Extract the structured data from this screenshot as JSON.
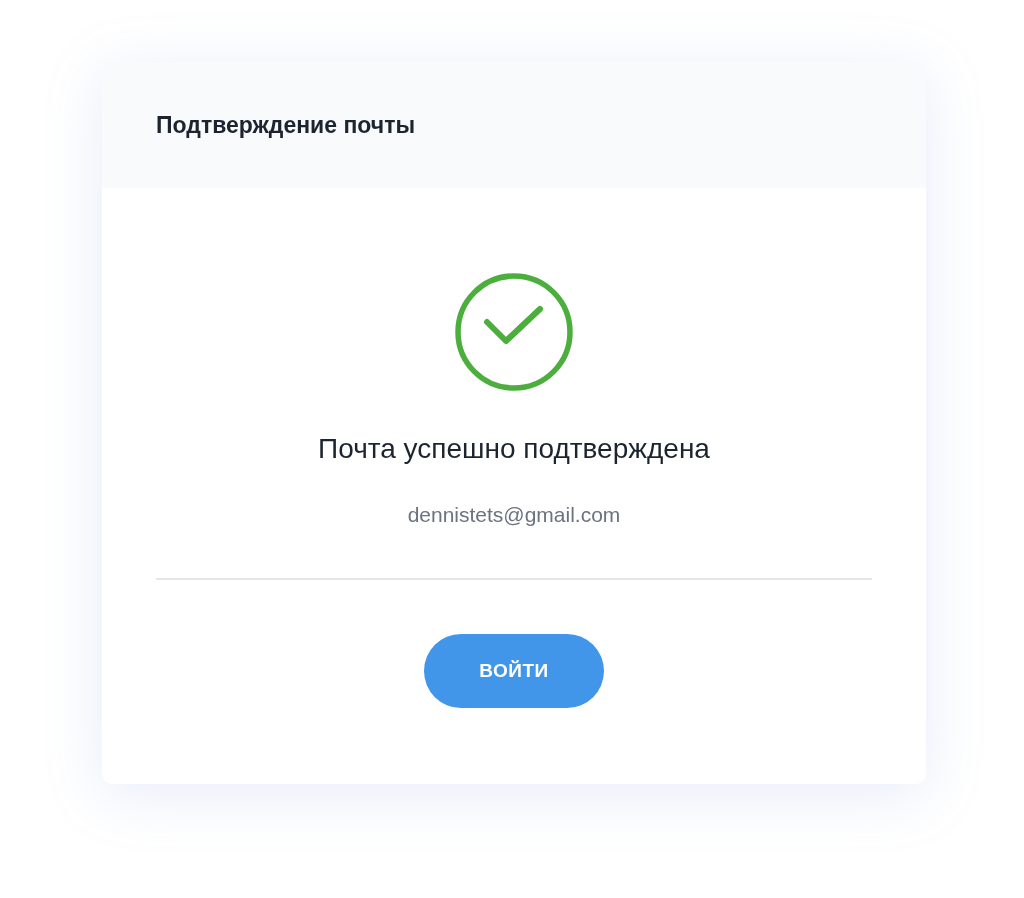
{
  "card": {
    "title": "Подтверждение почты"
  },
  "status": {
    "kind": "success",
    "message": "Почта успешно подтверждена",
    "email": "dennistets@gmail.com"
  },
  "buttons": [
    {
      "label": "ВОЙТИ"
    }
  ]
}
